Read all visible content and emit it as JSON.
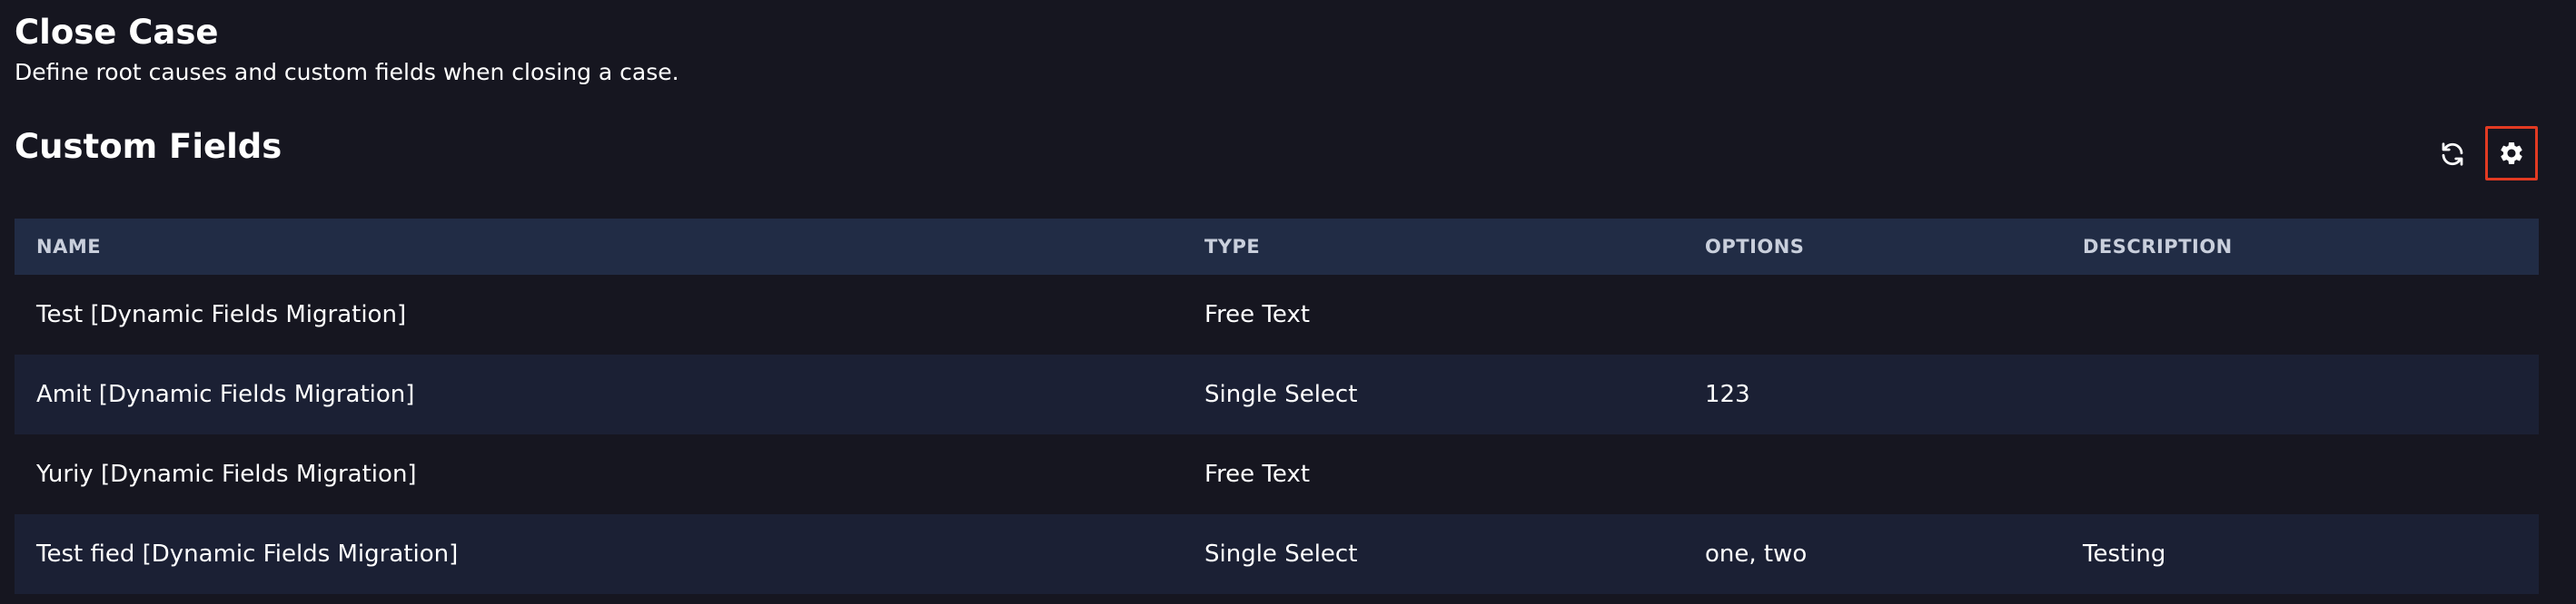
{
  "page": {
    "title": "Close Case",
    "subtitle": "Define root causes and custom fields when closing a case."
  },
  "section": {
    "title": "Custom Fields",
    "refresh_icon": "refresh-icon",
    "settings_icon": "gear-icon",
    "highlight_color": "#e23a22"
  },
  "table": {
    "columns": [
      "NAME",
      "TYPE",
      "OPTIONS",
      "DESCRIPTION"
    ],
    "rows": [
      {
        "name": "Test [Dynamic Fields Migration]",
        "type": "Free Text",
        "options": "",
        "description": ""
      },
      {
        "name": "Amit [Dynamic Fields Migration]",
        "type": "Single Select",
        "options": "123",
        "description": ""
      },
      {
        "name": "Yuriy [Dynamic Fields Migration]",
        "type": "Free Text",
        "options": "",
        "description": ""
      },
      {
        "name": "Test fied [Dynamic Fields Migration]",
        "type": "Single Select",
        "options": "one, two",
        "description": "Testing"
      }
    ]
  },
  "colors": {
    "background": "#161620",
    "header_row": "#212c45",
    "striped_row": "#1b2034"
  }
}
